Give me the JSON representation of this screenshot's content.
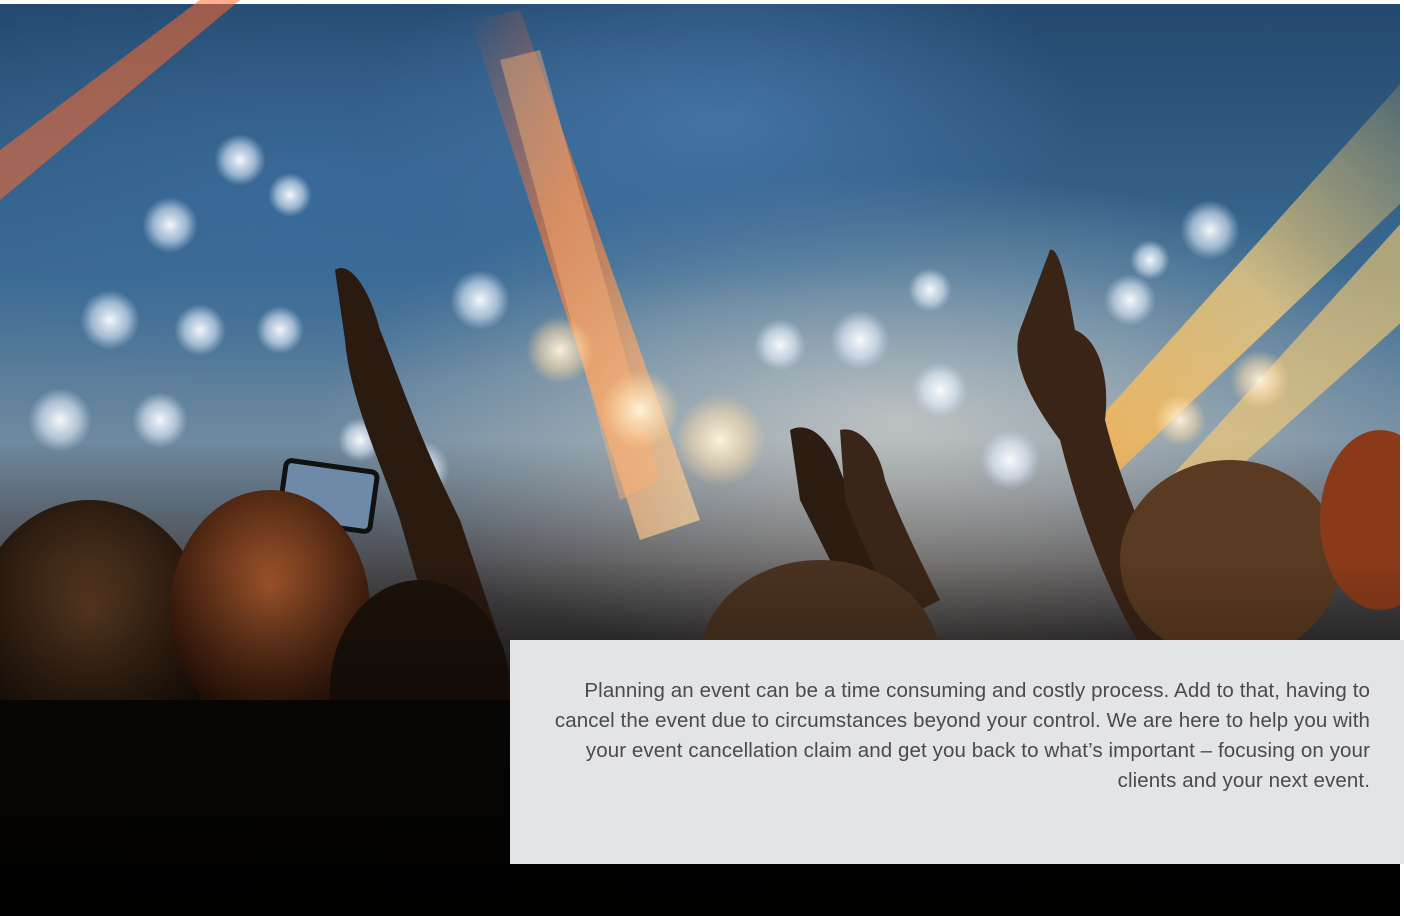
{
  "scene": {
    "description_icon": "concert-crowd-photo",
    "colors": {
      "sky": "#3a6a92",
      "panel_background": "#e3e4e6",
      "panel_text": "#4a4a4c",
      "flare_orange": "#ff8a3c",
      "flare_yellow": "#ffd37a"
    }
  },
  "caption": {
    "text": "Planning an event can be a time consuming and costly process. Add to that, having to cancel the event due to circumstances beyond your control. We are here to help you with your event cancellation claim and get you back to what’s important – focusing on your clients and your next event."
  }
}
